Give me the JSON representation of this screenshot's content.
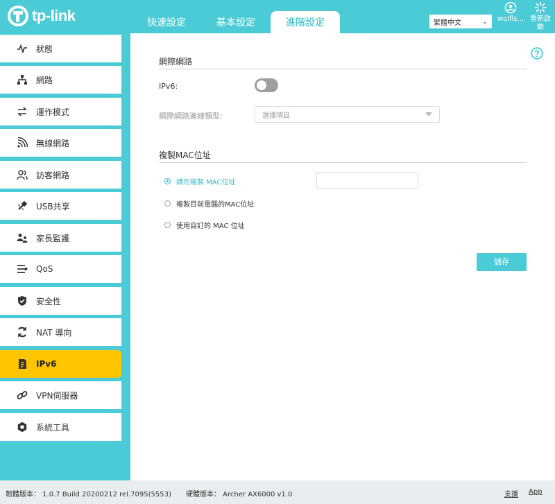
{
  "brand": {
    "logo_text": "tp-link"
  },
  "tabs": [
    {
      "label": "快速設定"
    },
    {
      "label": "基本設定"
    },
    {
      "label": "進階設定"
    }
  ],
  "header": {
    "language": "繁體中文",
    "account": "wolfls...",
    "reboot_line1": "重新啟",
    "reboot_line2": "動"
  },
  "sidebar": {
    "items": [
      {
        "label": "狀態",
        "icon": "status-pulse-icon"
      },
      {
        "label": "網路",
        "icon": "network-icon"
      },
      {
        "label": "運作模式",
        "icon": "operation-mode-icon"
      },
      {
        "label": "無線網路",
        "icon": "wireless-icon"
      },
      {
        "label": "訪客網路",
        "icon": "guest-network-icon"
      },
      {
        "label": "USB共享",
        "icon": "usb-icon"
      },
      {
        "label": "家長監護",
        "icon": "parental-control-icon"
      },
      {
        "label": "QoS",
        "icon": "qos-icon"
      },
      {
        "label": "安全性",
        "icon": "shield-icon"
      },
      {
        "label": "NAT 導向",
        "icon": "nat-icon"
      },
      {
        "label": "IPv6",
        "icon": "ipv6-icon"
      },
      {
        "label": "VPN伺服器",
        "icon": "vpn-link-icon"
      },
      {
        "label": "系統工具",
        "icon": "gear-icon"
      }
    ],
    "active": "IPv6"
  },
  "internet": {
    "title": "網際網路",
    "ipv6_label": "IPv6:",
    "ipv6_enabled": false,
    "conn_type_label": "網際網路連線類型:",
    "conn_type_placeholder": "選擇項目"
  },
  "mac_clone": {
    "title": "複製MAC位址",
    "options": [
      {
        "label": "請勿複製 MAC位址",
        "selected": true
      },
      {
        "label": "複製目前電腦的MAC位址",
        "selected": false
      },
      {
        "label": "使用自訂的 MAC 位址",
        "selected": false
      }
    ],
    "mac_value": ""
  },
  "actions": {
    "save_label": "儲存"
  },
  "footer": {
    "firmware": "韌體版本： 1.0.7 Build 20200212 rel.7095(5553)",
    "hardware": "硬體版本： Archer AX6000 v1.0",
    "support": "支援",
    "app": "App"
  },
  "colors": {
    "accent": "#4acbd6",
    "active_nav": "#ffc600",
    "link": "#2fb7c6"
  }
}
